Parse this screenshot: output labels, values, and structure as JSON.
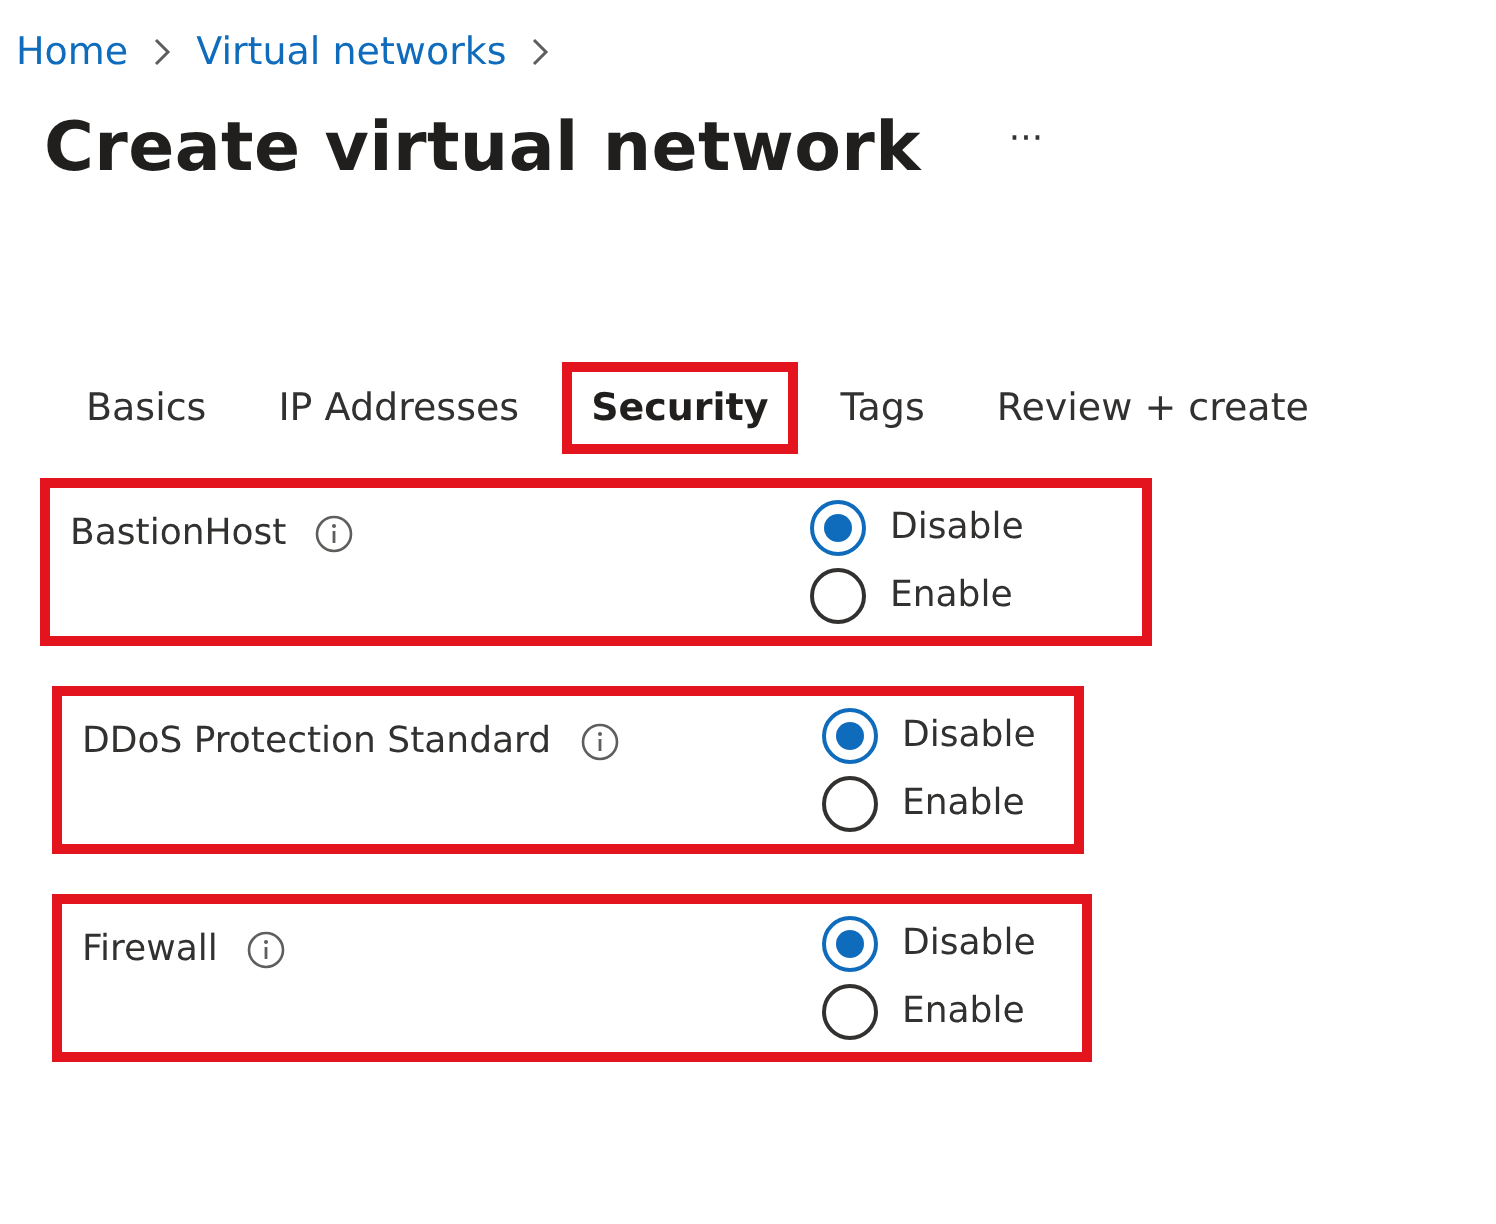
{
  "breadcrumb": [
    "Home",
    "Virtual networks"
  ],
  "title": "Create virtual network",
  "more_menu": "···",
  "tabs": [
    {
      "label": "Basics",
      "selected": false,
      "highlighted": false
    },
    {
      "label": "IP Addresses",
      "selected": false,
      "highlighted": false
    },
    {
      "label": "Security",
      "selected": true,
      "highlighted": true
    },
    {
      "label": "Tags",
      "selected": false,
      "highlighted": false
    },
    {
      "label": "Review + create",
      "selected": false,
      "highlighted": false
    }
  ],
  "settings": [
    {
      "label": "BastionHost",
      "highlighted": true,
      "options": [
        {
          "label": "Disable",
          "selected": true
        },
        {
          "label": "Enable",
          "selected": false
        }
      ]
    },
    {
      "label": "DDoS Protection Standard",
      "highlighted": true,
      "options": [
        {
          "label": "Disable",
          "selected": true
        },
        {
          "label": "Enable",
          "selected": false
        }
      ]
    },
    {
      "label": "Firewall",
      "highlighted": true,
      "options": [
        {
          "label": "Disable",
          "selected": true
        },
        {
          "label": "Enable",
          "selected": false
        }
      ]
    }
  ]
}
